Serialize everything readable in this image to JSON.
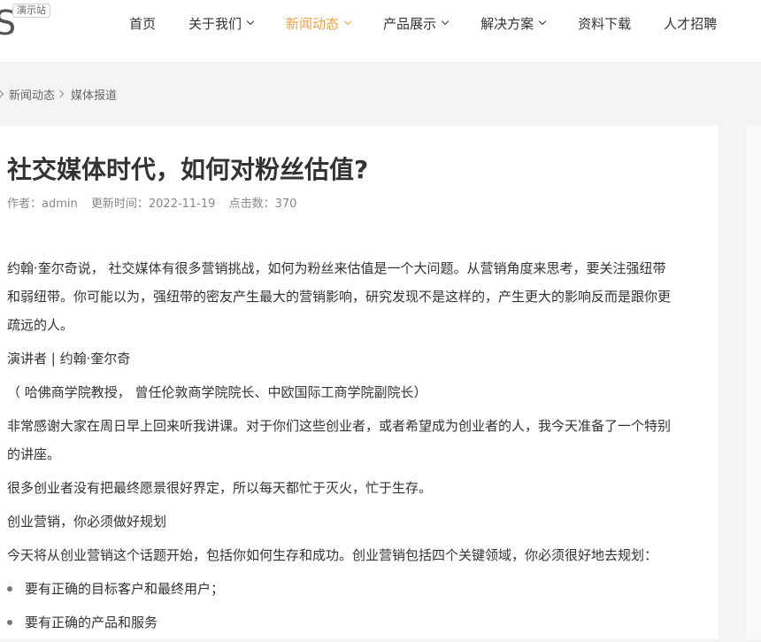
{
  "header": {
    "logo_letter": "S",
    "demo_badge": "演示站",
    "nav": [
      {
        "label": "首页",
        "dropdown": false,
        "active": false
      },
      {
        "label": "关于我们",
        "dropdown": true,
        "active": false
      },
      {
        "label": "新闻动态",
        "dropdown": true,
        "active": true
      },
      {
        "label": "产品展示",
        "dropdown": true,
        "active": false
      },
      {
        "label": "解决方案",
        "dropdown": true,
        "active": false
      },
      {
        "label": "资料下载",
        "dropdown": false,
        "active": false
      },
      {
        "label": "人才招聘",
        "dropdown": false,
        "active": false
      }
    ],
    "active_color": "#f0a23c"
  },
  "breadcrumb": [
    "新闻动态",
    "媒体报道"
  ],
  "article": {
    "title": "社交媒体时代，如何对粉丝估值?",
    "meta": {
      "author": "作者：admin",
      "updated": "更新时间：2022-11-19",
      "clicks": "点击数：370"
    },
    "paragraphs": [
      "约翰·奎尔奇说， 社交媒体有很多营销挑战，如何为粉丝来估值是一个大问题。从营销角度来思考，要关注强纽带和弱纽带。你可能以为，强纽带的密友产生最大的营销影响，研究发现不是这样的，产生更大的影响反而是跟你更疏远的人。",
      "演讲者 |  约翰·奎尔奇",
      "（ 哈佛商学院教授， 曾任伦敦商学院院长、中欧国际工商学院副院长）",
      "非常感谢大家在周日早上回来听我讲课。对于你们这些创业者，或者希望成为创业者的人，我今天准备了一个特别的讲座。",
      "很多创业者没有把最终愿景很好界定，所以每天都忙于灭火，忙于生存。",
      "创业营销，你必须做好规划",
      "今天将从创业营销这个话题开始，包括你如何生存和成功。创业营销包括四个关键领域，你必须很好地去规划："
    ],
    "list": [
      "要有正确的目标客户和最终用户；",
      "要有正确的产品和服务"
    ]
  }
}
